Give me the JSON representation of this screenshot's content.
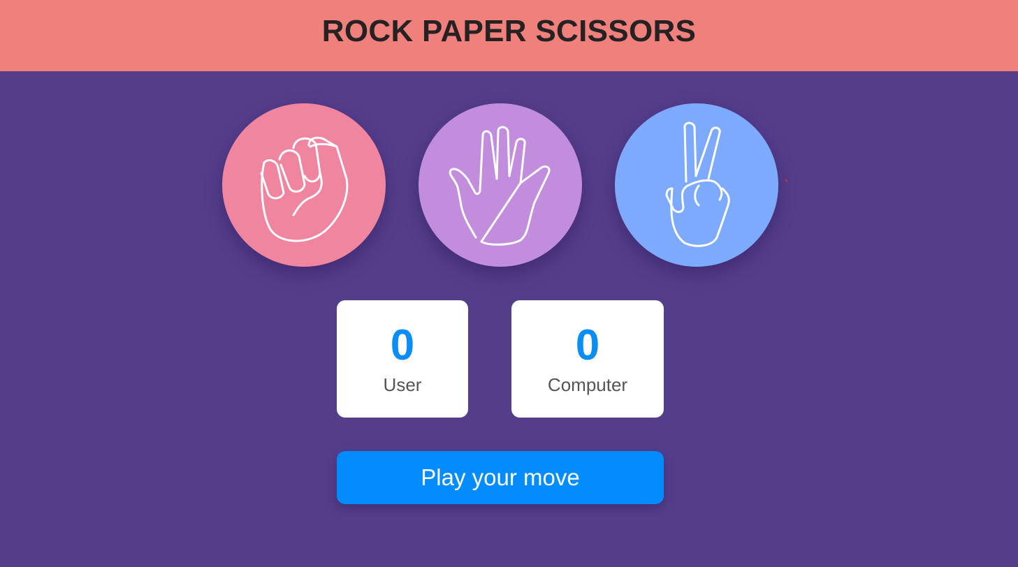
{
  "header": {
    "title": "ROCK PAPER SCISSORS"
  },
  "choices": [
    {
      "name": "rock",
      "icon": "fist-icon",
      "color": "#f085a0"
    },
    {
      "name": "paper",
      "icon": "open-hand-icon",
      "color": "#c28ddc"
    },
    {
      "name": "scissors",
      "icon": "peace-sign-icon",
      "color": "#7eaafd"
    }
  ],
  "scores": {
    "user": {
      "value": "0",
      "label": "User"
    },
    "computer": {
      "value": "0",
      "label": "Computer"
    }
  },
  "play_button": {
    "label": "Play your move",
    "color": "#038cfd"
  },
  "colors": {
    "header_bg": "#f0807c",
    "page_bg": "#543d8b",
    "score_text": "#0a8ef5"
  }
}
